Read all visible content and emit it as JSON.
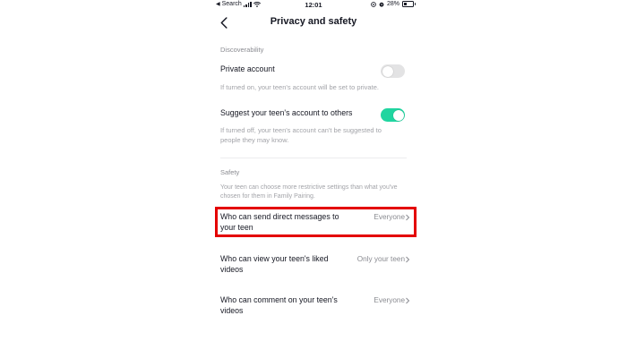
{
  "status_bar": {
    "carrier": "Search",
    "time": "12:01",
    "battery": "28%",
    "battery_level": 0.28
  },
  "header": {
    "title": "Privacy and safety",
    "back_icon": "chevron-left-icon"
  },
  "discoverability": {
    "label": "Discoverability",
    "private_account": {
      "title": "Private account",
      "description": "If turned on, your teen's account will be set to private.",
      "enabled": false
    },
    "suggest_account": {
      "title": "Suggest your teen's account to others",
      "description_line1": "If turned off, your teen's account can't be suggested to",
      "description_line2": "people they may know.",
      "enabled": true
    }
  },
  "safety": {
    "label": "Safety",
    "description_line1": "Your teen can choose more restrictive settings than what you've",
    "description_line2": "chosen for them in Family Pairing.",
    "rows": [
      {
        "title_line1": "Who can send direct messages to",
        "title_line2": "your teen",
        "value": "Everyone"
      },
      {
        "title_line1": "Who can view your teen's liked",
        "title_line2": "videos",
        "value": "Only your teen"
      },
      {
        "title_line1": "Who can comment on your teen's",
        "title_line2": "videos",
        "value": "Everyone"
      }
    ]
  },
  "colors": {
    "toggle_on": "#20d5a0",
    "toggle_off": "#e3e3e4",
    "highlight": "#e40000"
  }
}
